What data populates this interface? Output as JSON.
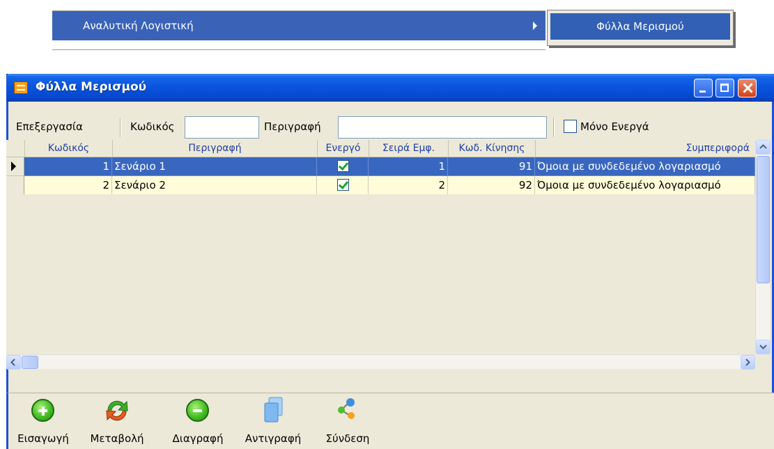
{
  "menu": {
    "parent_item": "Αναλυτική Λογιστική",
    "submenu_item": "Φύλλα Μερισμού"
  },
  "window": {
    "title": "Φύλλα Μερισμού"
  },
  "toolbar": {
    "edit_label": "Επεξεργασία",
    "code_label": "Κωδικός",
    "code_value": "",
    "description_label": "Περιγραφή",
    "description_value": "",
    "active_only_label": "Μόνο Ενεργά",
    "active_only_checked": false
  },
  "grid": {
    "columns": [
      "Κωδικός",
      "Περιγραφή",
      "Ενεργό",
      "Σειρά Εμφ.",
      "Κωδ. Κίνησης",
      "Συμπεριφορά"
    ],
    "rows": [
      {
        "code": "1",
        "description": "Σενάριο 1",
        "active": true,
        "order": "1",
        "movement_code": "91",
        "behavior": "Όμοια με συνδεδεμένο λογαριασμό",
        "selected": true
      },
      {
        "code": "2",
        "description": "Σενάριο 2",
        "active": true,
        "order": "2",
        "movement_code": "92",
        "behavior": "Όμοια με συνδεδεμένο λογαριασμό",
        "selected": false
      }
    ]
  },
  "actions": {
    "insert": "Εισαγωγή",
    "edit": "Μεταβολή",
    "delete": "Διαγραφή",
    "copy": "Αντιγραφή",
    "link": "Σύνδεση"
  },
  "colors": {
    "titlebar": "#0a52dc",
    "selected_row": "#3967c0",
    "alt_row": "#fefcd9",
    "menu_highlight": "#3a63b8"
  }
}
